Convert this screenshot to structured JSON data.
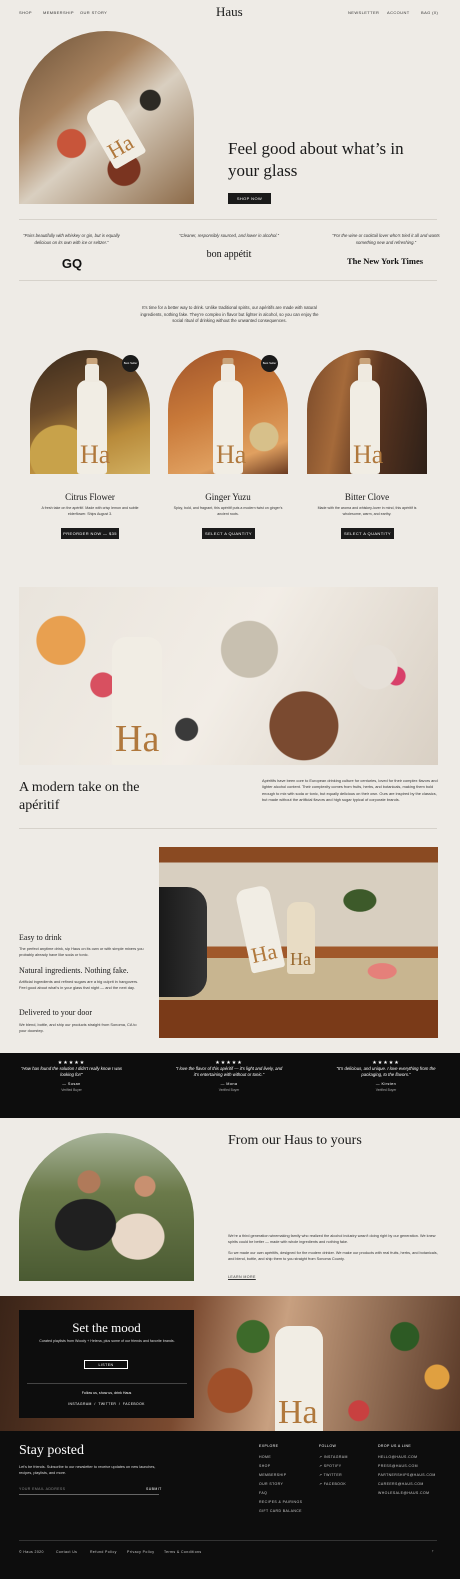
{
  "nav": {
    "left": [
      "Shop",
      "Membership",
      "Our Story"
    ],
    "logo": "Haus",
    "right": [
      "Newsletter",
      "Account",
      "Bag (0)"
    ]
  },
  "hero": {
    "headline": "Feel good about what’s in your glass",
    "cta": "Shop now"
  },
  "press": [
    {
      "quote": "“Pairs beautifully with whiskey or gin, but is equally delicious on its own with ice or seltzer.”",
      "publication": "GQ"
    },
    {
      "quote": "“Cleaner, responsibly sourced, and lower in alcohol.”",
      "publication": "bon appétit"
    },
    {
      "quote": "“For the wine or cocktail lover who’s tried it all and wants something new and refreshing.”",
      "publication": "The New York Times"
    }
  ],
  "intro": "It’s time for a better way to drink. Unlike traditional spirits, our apéritifs are made with natural ingredients, nothing fake. They’re complex in flavor but lighter in alcohol, so you can enjoy the social ritual of drinking without the unwanted consequences.",
  "products": [
    {
      "name": "Citrus Flower",
      "badge": "Best Seller",
      "desc": "A fresh take on the apéritif. Made with crisp lemon and subtle elderflower. Ships August 3.",
      "cta": "Preorder now — $35"
    },
    {
      "name": "Ginger Yuzu",
      "badge": "Best Seller",
      "desc": "Spicy, bold, and fragrant, this apéritif puts a modern twist on ginger’s ancient roots.",
      "cta": "Select a quantity"
    },
    {
      "name": "Bitter Clove",
      "badge": "",
      "desc": "Made with the aroma and whiskey-lover in mind, this apéritif is wholesome, warm, and earthy.",
      "cta": "Select a quantity"
    }
  ],
  "bottle_text": "Ha",
  "modern": {
    "heading": "A modern take on the apéritif",
    "body": "Apéritifs have been core to European drinking culture for centuries, loved for their complex flavors and lighter alcohol content. Their complexity comes from fruits, herbs, and botanicals, making them bold enough to mix with soda or tonic, but equally delicious on their own. Ours are inspired by the classics, but made without the artificial flavors and high sugar typical of corporate brands."
  },
  "features": [
    {
      "title": "Easy to drink",
      "body": "The perfect anytime drink, sip Haus on its own or with simple mixers you probably already have like soda or tonic."
    },
    {
      "title": "Natural ingredients. Nothing fake.",
      "body": "Artificial ingredients and refined sugars are a big culprit in hangovers. Feel good about what’s in your glass that night — and the next day."
    },
    {
      "title": "Delivered to your door",
      "body": "We blend, bottle, and ship our products straight from Sonoma, CA to your doorstep."
    }
  ],
  "reviews": [
    {
      "stars": "★★★★★",
      "quote": "“How has found the solution I didn’t really know I was looking for!”",
      "name": "— Susan",
      "verified": "Verified Buyer"
    },
    {
      "stars": "★★★★★",
      "quote": "“I love the flavor of this apéritif — it’s light and lively, and it’s entertaining with without or tonic.”",
      "name": "— Mona",
      "verified": "Verified Buyer"
    },
    {
      "stars": "★★★★★",
      "quote": "“It’s delicious, and unique. I love everything from the packaging, to the flavors.”",
      "name": "— Kirsten",
      "verified": "Verified Buyer"
    }
  ],
  "family": {
    "heading": "From our Haus to yours",
    "p1": "We’re a third generation winemaking family who realized the alcohol industry wasn’t doing right by our generation. We knew spirits could be better — made with whole ingredients and nothing fake.",
    "p2": "So we made our own apéritifs, designed for the modern drinker. We make our products with real fruits, herbs, and botanicals, and blend, bottle, and ship them to you straight from Sonoma County.",
    "link": "Learn more"
  },
  "mood": {
    "heading": "Set the mood",
    "body": "Curated playlists from Woody + Helena, plus some of our friends and favorite brands.",
    "cta": "Listen",
    "follow": "Follow us, show us, drink Haus",
    "social": "Instagram  /  Twitter  /  Facebook"
  },
  "footer": {
    "heading": "Stay posted",
    "body": "Let’s be friends. Subscribe to our newsletter to receive updates on new launches, recipes, playlists, and more.",
    "email_placeholder": "Your email address",
    "submit": "Submit",
    "explore_title": "Explore",
    "explore": [
      "Home",
      "Shop",
      "Membership",
      "Our Story",
      "FAQ",
      "Recipes & Pairings",
      "Gift Card Balance"
    ],
    "follow_title": "Follow",
    "follow": [
      "↗ Instagram",
      "↗ Spotify",
      "↗ Twitter",
      "↗ Facebook"
    ],
    "contact_title": "Drop us a line",
    "contact": [
      "Hello@Haus.com",
      "Press@Haus.com",
      "Partnerships@Haus.com",
      "Careers@Haus.com",
      "Wholesale@Haus.com"
    ],
    "copyright": "© Haus 2020",
    "legal": [
      "Contact Us",
      "Refund Policy",
      "Privacy Policy",
      "Terms & Conditions"
    ]
  },
  "colors": {
    "dark": "#1a1a1a",
    "background": "#eeebe6",
    "accent": "#b0783c"
  }
}
